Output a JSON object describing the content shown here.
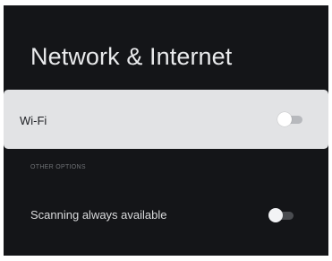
{
  "page": {
    "title": "Network & Internet"
  },
  "wifi": {
    "label": "Wi-Fi",
    "toggle_on": false
  },
  "other_options": {
    "header": "OTHER OPTIONS",
    "scanning": {
      "label": "Scanning always available",
      "toggle_on": false
    }
  },
  "colors": {
    "background": "#141518",
    "focused_row": "#e2e3e5",
    "title_text": "#e9eaec",
    "section_text": "#6f7276"
  }
}
